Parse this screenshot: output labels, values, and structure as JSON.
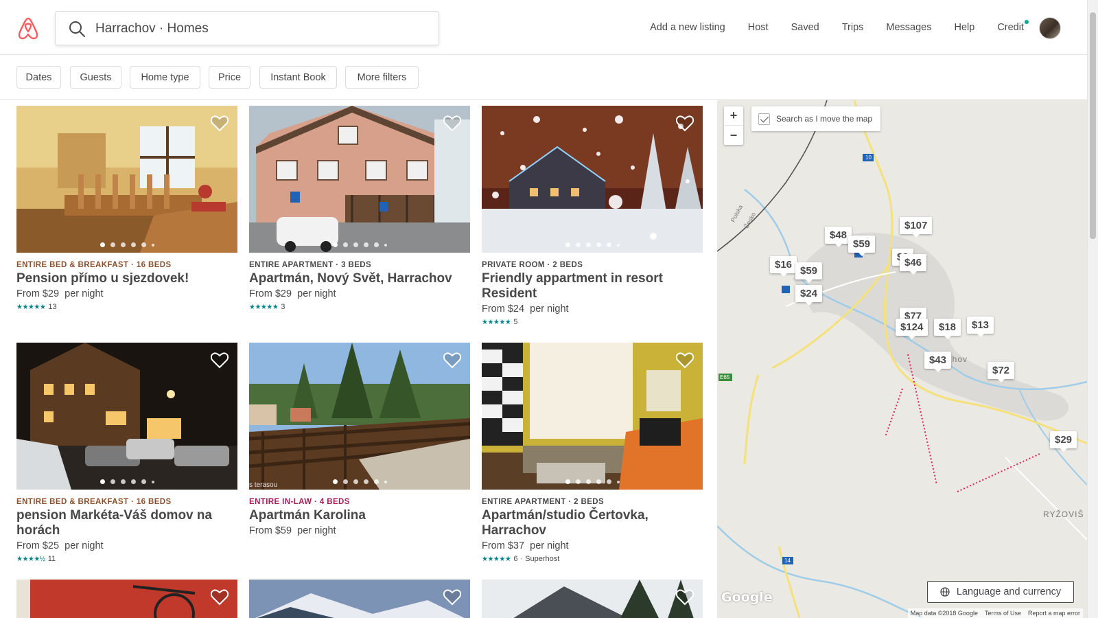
{
  "header": {
    "search_query": "Harrachov · Homes",
    "nav": [
      "Add a new listing",
      "Host",
      "Saved",
      "Trips",
      "Messages",
      "Help",
      "Credit"
    ],
    "accent": "#FF5A5F"
  },
  "filters": [
    "Dates",
    "Guests",
    "Home type",
    "Price",
    "Instant Book",
    "More filters"
  ],
  "listings": [
    {
      "kind": "Entire bed & breakfast · 16 beds",
      "kind_color": "#8C4F2B",
      "title": "Pension přímo u sjezdovek!",
      "price": "From $29",
      "per": "per night",
      "stars": "★★★★★",
      "reviews": "13",
      "extra": "",
      "caption": ""
    },
    {
      "kind": "Entire apartment · 3 beds",
      "kind_color": "#484848",
      "title": "Apartmán, Nový Svět, Harrachov",
      "price": "From $29",
      "per": "per night",
      "stars": "★★★★★",
      "reviews": "3",
      "extra": "",
      "caption": ""
    },
    {
      "kind": "Private room · 2 beds",
      "kind_color": "#484848",
      "title": "Friendly appartment in resort Resident",
      "price": "From $24",
      "per": "per night",
      "stars": "★★★★★",
      "reviews": "5",
      "extra": "",
      "caption": ""
    },
    {
      "kind": "Entire bed & breakfast · 16 beds",
      "kind_color": "#8C4F2B",
      "title": "pension Markéta-Váš domov na horách",
      "price": "From $25",
      "per": "per night",
      "stars": "★★★★½",
      "reviews": "11",
      "extra": "",
      "caption": ""
    },
    {
      "kind": "Entire in-law · 4 beds",
      "kind_color": "#A61D55",
      "title": "Apartmán Karolina",
      "price": "From $59",
      "per": "per night",
      "stars": "",
      "reviews": "",
      "extra": "",
      "caption": "s terasou"
    },
    {
      "kind": "Entire apartment · 2 beds",
      "kind_color": "#484848",
      "title": "Apartmán/studio Čertovka, Harrachov",
      "price": "From $37",
      "per": "per night",
      "stars": "★★★★★",
      "reviews": "6",
      "extra": "· Superhost",
      "caption": ""
    }
  ],
  "map": {
    "search_as_move": "Search as I move the map",
    "zoom_in": "+",
    "zoom_out": "−",
    "pins": [
      "$48",
      "$59",
      "$107",
      "$2",
      "$46",
      "$16",
      "$59",
      "$24",
      "$77",
      "$124",
      "$18",
      "$13",
      "$43",
      "$72",
      "$29"
    ],
    "labels": [
      "Polska",
      "Česko",
      "achov",
      "RYŽOVIŠ",
      "10",
      "14",
      "E65",
      "10"
    ],
    "language_button": "Language and currency",
    "google": "Google",
    "attribution": [
      "Map data ©2018 Google",
      "Terms of Use",
      "Report a map error"
    ]
  }
}
